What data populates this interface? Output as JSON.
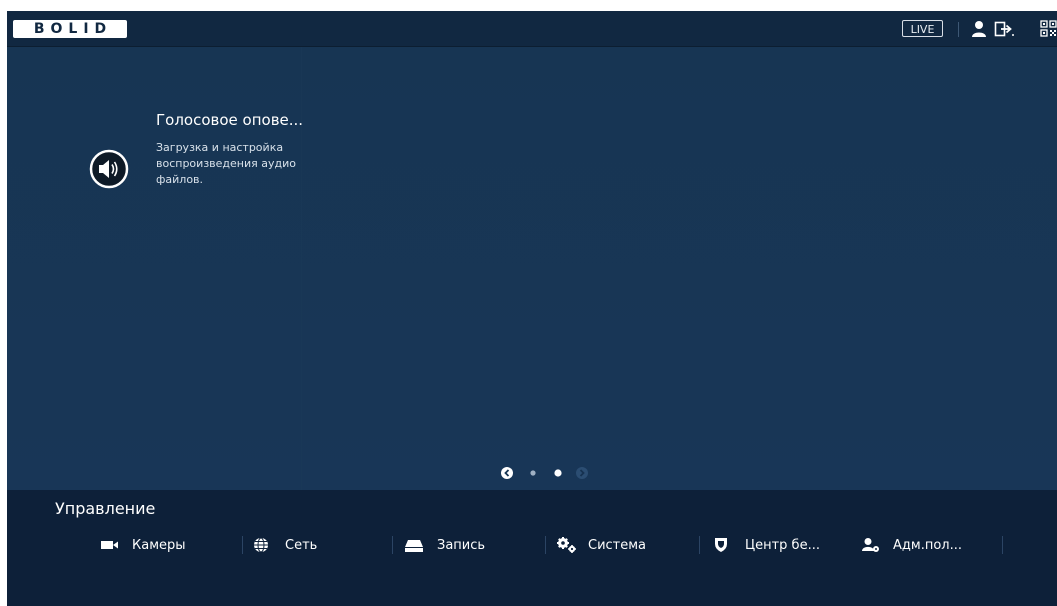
{
  "brand": {
    "logo_text": "BOLID"
  },
  "topbar": {
    "live_label": "LIVE",
    "icons": [
      "user-icon",
      "logout-icon",
      "qr-code-icon"
    ]
  },
  "feature": {
    "icon": "speaker-icon",
    "title": "Голосовое опове...",
    "description": "Загрузка и настройка воспроизведения аудио файлов."
  },
  "pager": {
    "pages": 2,
    "current_page": 2
  },
  "management": {
    "title": "Управление",
    "items": [
      {
        "label": "Камеры",
        "icon": "camera-icon"
      },
      {
        "label": "Сеть",
        "icon": "globe-icon"
      },
      {
        "label": "Запись",
        "icon": "hdd-icon"
      },
      {
        "label": "Система",
        "icon": "gears-icon"
      },
      {
        "label": "Центр бе...",
        "icon": "shield-icon"
      },
      {
        "label": "Адм.пол...",
        "icon": "user-settings-icon"
      }
    ]
  },
  "colors": {
    "content_bg": "#163250",
    "topbar_bg": "#112841",
    "bottom_bg": "#0d2039",
    "text": "#ffffff"
  }
}
